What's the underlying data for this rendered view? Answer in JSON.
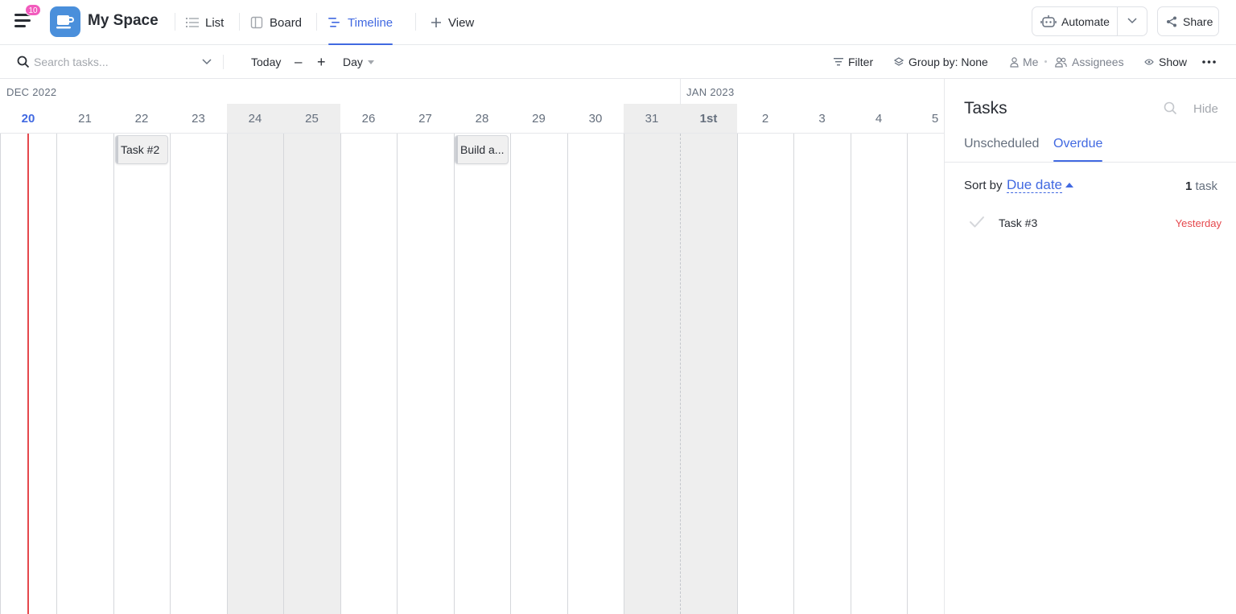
{
  "header": {
    "notifications": "10",
    "space_title": "My Space",
    "tabs": [
      {
        "label": "List",
        "icon": "list-icon"
      },
      {
        "label": "Board",
        "icon": "board-icon"
      },
      {
        "label": "Timeline",
        "icon": "timeline-icon",
        "active": true
      },
      {
        "label": "View",
        "icon": "plus-icon"
      }
    ],
    "automate_label": "Automate",
    "share_label": "Share"
  },
  "toolbar": {
    "search_placeholder": "Search tasks...",
    "today_label": "Today",
    "zoom_out": "–",
    "zoom_in": "+",
    "scale_label": "Day",
    "filter_label": "Filter",
    "group_by_label": "Group by: None",
    "me_label": "Me",
    "assignees_label": "Assignees",
    "show_label": "Show"
  },
  "timeline": {
    "months": [
      "DEC 2022",
      "JAN 2023"
    ],
    "days": [
      "20",
      "21",
      "22",
      "23",
      "24",
      "25",
      "26",
      "27",
      "28",
      "29",
      "30",
      "31",
      "1st",
      "2",
      "3",
      "4",
      "5"
    ],
    "weekend_days": [
      "24",
      "25",
      "31",
      "1st"
    ],
    "today": "20",
    "tasks": [
      {
        "label": "Task #2",
        "day": "22"
      },
      {
        "label": "Build a...",
        "day": "28"
      }
    ]
  },
  "panel": {
    "title": "Tasks",
    "hide_label": "Hide",
    "tabs": [
      "Unscheduled",
      "Overdue"
    ],
    "active_tab": "Overdue",
    "sort_label": "Sort by",
    "sort_value": "Due date",
    "count_number": "1",
    "count_unit": "task",
    "tasks": [
      {
        "name": "Task #3",
        "due": "Yesterday"
      }
    ]
  },
  "colors": {
    "accent": "#4169e1",
    "today_line": "#e5484d",
    "overdue": "#e5484d",
    "badge": "#f25bbd",
    "space_avatar": "#4a8fdb"
  }
}
